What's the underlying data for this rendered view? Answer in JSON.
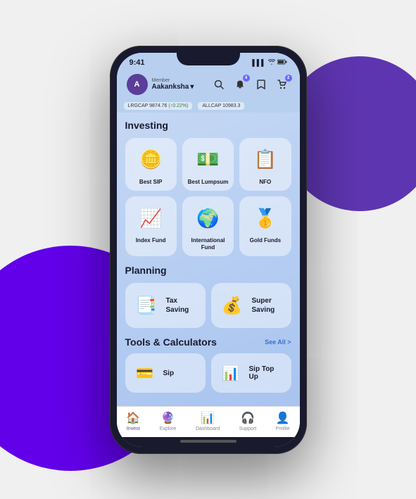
{
  "background": {
    "circle_left_color": "#5c2d91",
    "circle_right_color": "#4527a0"
  },
  "status_bar": {
    "time": "9:41",
    "signal": "▌▌▌",
    "wifi": "wifi",
    "battery": "battery"
  },
  "header": {
    "avatar_letter": "A",
    "member_label": "Member",
    "user_name": "Aakanksha",
    "chevron": "›",
    "notifications_badge": "4",
    "cart_badge": "2"
  },
  "ticker": [
    {
      "label": "LRGCAP",
      "value": "9874.76",
      "change": "(↑0.22%)"
    },
    {
      "label": "ALLCAP",
      "value": "10983.3",
      "change": ""
    }
  ],
  "investing": {
    "section_title": "Investing",
    "items": [
      {
        "label": "Best SIP",
        "icon": "🪙"
      },
      {
        "label": "Best Lumpsum",
        "icon": "💵"
      },
      {
        "label": "NFO",
        "icon": "📋"
      },
      {
        "label": "Index Fund",
        "icon": "📈"
      },
      {
        "label": "International Fund",
        "icon": "🌍"
      },
      {
        "label": "Gold Funds",
        "icon": "🥇"
      }
    ]
  },
  "planning": {
    "section_title": "Planning",
    "items": [
      {
        "label": "Tax Saving",
        "icon": "📑"
      },
      {
        "label": "Super Saving",
        "icon": "💰"
      }
    ]
  },
  "tools": {
    "section_title": "Tools & Calculators",
    "see_all": "See All >",
    "items": [
      {
        "label": "Sip",
        "icon": "💳"
      },
      {
        "label": "Sip Top Up",
        "icon": "📊"
      }
    ]
  },
  "bottom_nav": {
    "items": [
      {
        "label": "Invest",
        "icon": "🏠",
        "active": true
      },
      {
        "label": "Explore",
        "icon": "🔮",
        "active": false
      },
      {
        "label": "Dashboard",
        "icon": "📊",
        "active": false
      },
      {
        "label": "Support",
        "icon": "🎧",
        "active": false
      },
      {
        "label": "Profile",
        "icon": "👤",
        "active": false
      }
    ]
  }
}
